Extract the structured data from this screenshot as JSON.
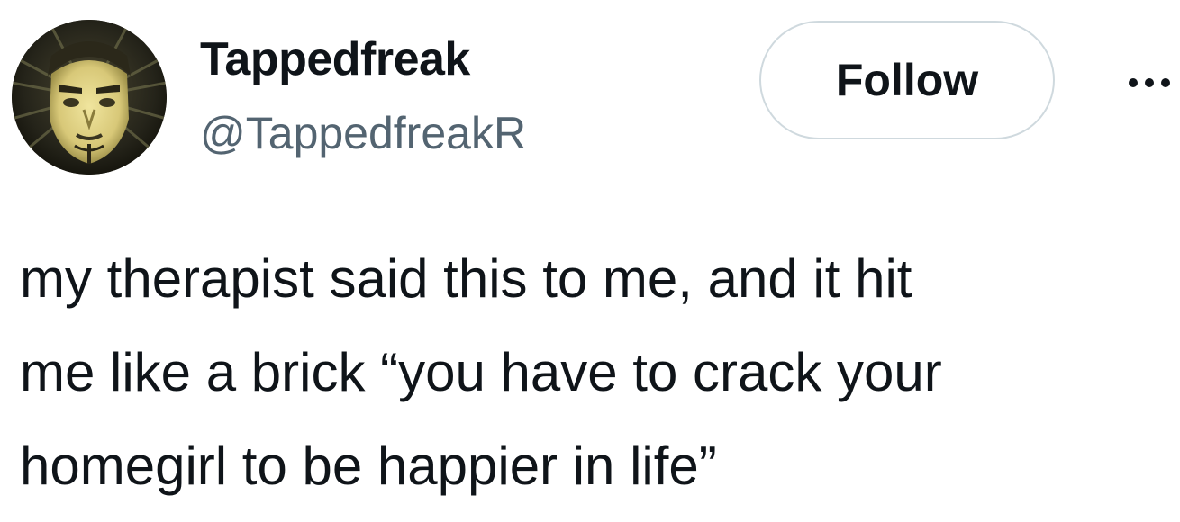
{
  "author": {
    "display_name": "Tappedfreak",
    "handle": "@TappedfreakR",
    "avatar_icon": "profile-photo"
  },
  "actions": {
    "follow_label": "Follow",
    "more_icon": "more-options-icon"
  },
  "tweet": {
    "text": "my therapist said this to me, and it hit\nme like a brick “you have to crack your\nhomegirl to be happier in life”"
  },
  "colors": {
    "text_primary": "#0f1419",
    "text_secondary": "#536471",
    "button_border": "#cfd9de"
  }
}
